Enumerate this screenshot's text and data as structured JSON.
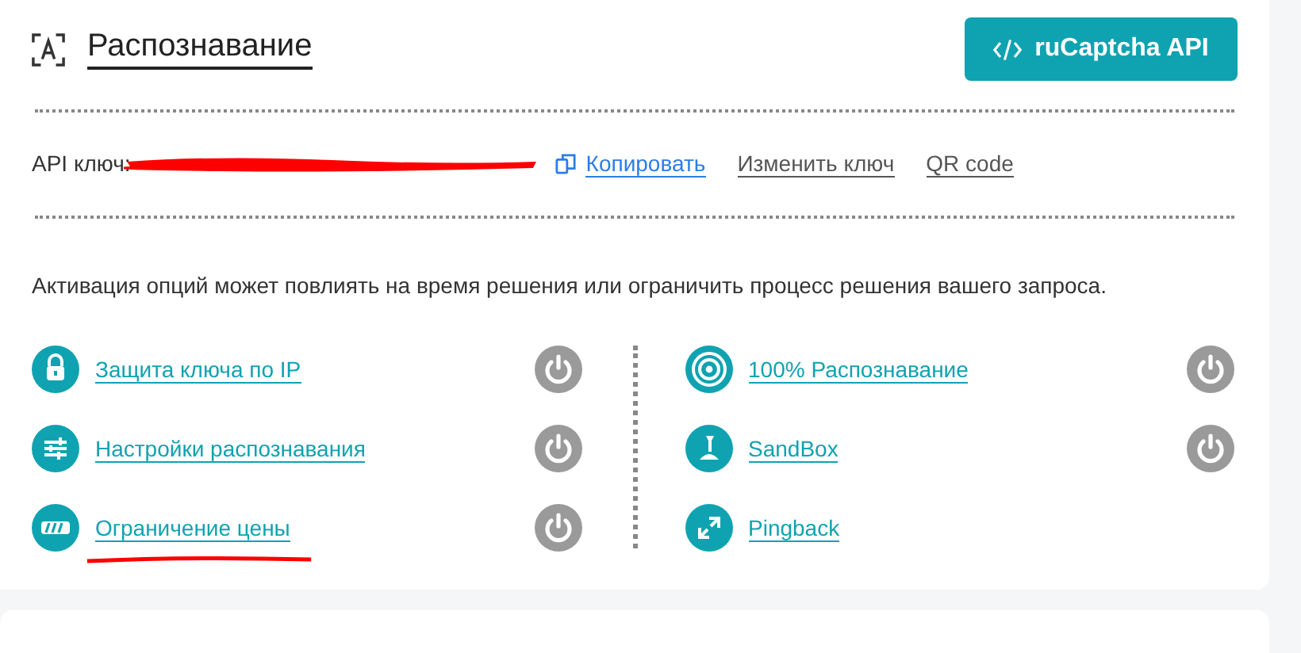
{
  "header": {
    "title": "Распознавание",
    "api_button": "ruCaptcha API"
  },
  "api_key": {
    "label": "API ключ:",
    "actions": [
      "Копировать",
      "Изменить ключ",
      "QR code"
    ]
  },
  "description": "Активация опций может повлиять на время решения или ограничить процесс решения вашего запроса.",
  "options_left": [
    {
      "kind": "lock",
      "label": "Защита ключа по IP",
      "on": false
    },
    {
      "kind": "sliders",
      "label": "Настройки распознавания",
      "on": false
    },
    {
      "kind": "price",
      "label": "Ограничение цены",
      "on": false
    }
  ],
  "options_right": [
    {
      "kind": "target",
      "label": "100% Распознавание",
      "on": false
    },
    {
      "kind": "joystick",
      "label": "SandBox",
      "on": false
    },
    {
      "kind": "arrows",
      "label": "Pingback"
    }
  ]
}
